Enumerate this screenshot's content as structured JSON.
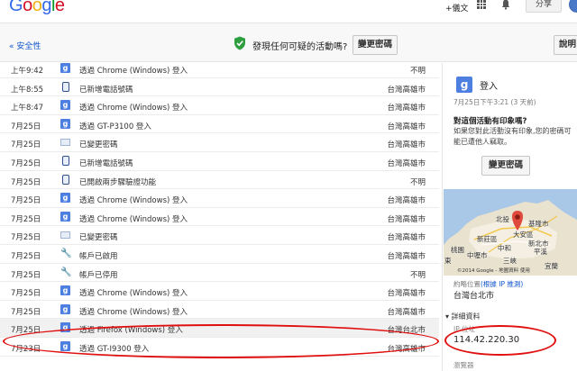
{
  "header": {
    "logo": [
      "G",
      "o",
      "o",
      "g",
      "l",
      "e"
    ],
    "logo_colors": [
      "#3369e8",
      "#d50f25",
      "#eeb211",
      "#3369e8",
      "#009925",
      "#d50f25"
    ],
    "plus_you": "+儀文",
    "share_label": "分享"
  },
  "subheader": {
    "back_link": "« 安全性",
    "question": "發現任何可疑的活動嗎?",
    "change_password": "變更密碼",
    "explain": "說明"
  },
  "events": [
    {
      "date": "上午9:42",
      "icon": "google-icon",
      "text": "透過 Chrome (Windows) 登入",
      "location": "不明"
    },
    {
      "date": "上午8:55",
      "icon": "phone-icon",
      "text": "已新增電話號碼",
      "location": "台灣高雄市"
    },
    {
      "date": "上午8:47",
      "icon": "google-icon",
      "text": "透過 Chrome (Windows) 登入",
      "location": "台灣高雄市"
    },
    {
      "date": "7月25日",
      "icon": "google-icon",
      "text": "透過 GT-P3100 登入",
      "location": "台灣高雄市"
    },
    {
      "date": "7月25日",
      "icon": "password-icon",
      "text": "已變更密碼",
      "location": "台灣高雄市"
    },
    {
      "date": "7月25日",
      "icon": "phone-icon",
      "text": "已新增電話號碼",
      "location": "台灣高雄市"
    },
    {
      "date": "7月25日",
      "icon": "phone-icon",
      "text": "已開啟兩步驟驗證功能",
      "location": "不明"
    },
    {
      "date": "7月25日",
      "icon": "google-icon",
      "text": "透過 Chrome (Windows) 登入",
      "location": "台灣高雄市"
    },
    {
      "date": "7月25日",
      "icon": "google-icon",
      "text": "透過 Chrome (Windows) 登入",
      "location": "台灣高雄市"
    },
    {
      "date": "7月25日",
      "icon": "password-icon",
      "text": "已變更密碼",
      "location": "台灣高雄市"
    },
    {
      "date": "7月25日",
      "icon": "wrench-icon",
      "text": "帳戶已啟用",
      "location": "台灣高雄市"
    },
    {
      "date": "7月25日",
      "icon": "wrench-icon",
      "text": "帳戶已停用",
      "location": "不明"
    },
    {
      "date": "7月25日",
      "icon": "google-icon",
      "text": "透過 Chrome (Windows) 登入",
      "location": "台灣高雄市"
    },
    {
      "date": "7月25日",
      "icon": "google-icon",
      "text": "透過 Chrome (Windows) 登入",
      "location": "台灣高雄市"
    },
    {
      "date": "7月25日",
      "icon": "google-icon",
      "text": "透過 Firefox (Windows) 登入",
      "location": "台灣台北市",
      "selected": true
    },
    {
      "date": "7月23日",
      "icon": "google-icon",
      "text": "透過 GT-I9300 登入",
      "location": "台灣高雄市"
    }
  ],
  "detail": {
    "title": "登入",
    "time": "7月25日下午3:21 (3 天前)",
    "question": "對這個活動有印象嗎?",
    "body": "如果您對此活動沒有印象,您的密碼可能已遭他人竊取。",
    "change_password": "變更密碼",
    "map_labels": {
      "a": "北投",
      "b": "基隆市",
      "c": "大安區",
      "d": "新莊區",
      "e": "中和",
      "f": "新北市",
      "g": "桃園",
      "h": "中壢市",
      "i": "三峽",
      "j": "平溪",
      "k": "宜蘭",
      "l": "東"
    },
    "map_footer": "©2014 Google - 地圖資料 使用",
    "location_label": "約略位置",
    "location_link": "(根據 IP 推測)",
    "location": "台灣台北市",
    "details_toggle": "▾ 詳細資料",
    "ip_label": "IP 位址",
    "ip": "114.42.220.30",
    "browser_label": "瀏覽器"
  },
  "colors": {
    "link": "#1155cc",
    "google_blue": "#4d7fe0",
    "annotation": "#e01010",
    "shield": "#2e9e3f"
  }
}
